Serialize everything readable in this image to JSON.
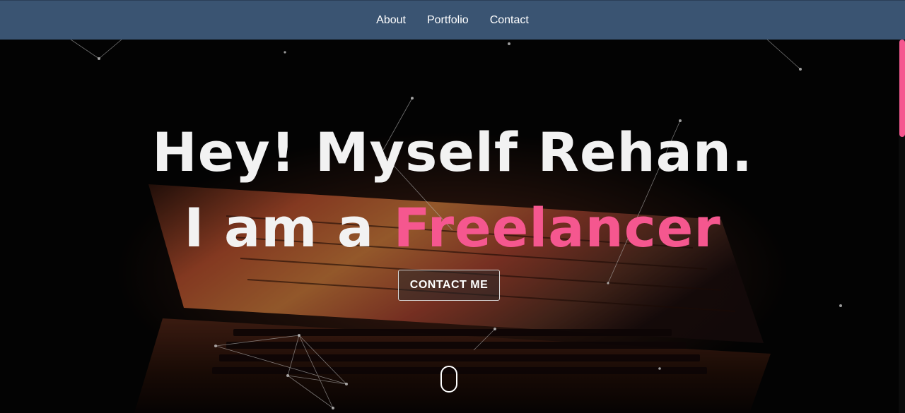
{
  "nav": {
    "items": [
      {
        "label": "About"
      },
      {
        "label": "Portfolio"
      },
      {
        "label": "Contact"
      }
    ]
  },
  "hero": {
    "line1": "Hey! Myself Rehan.",
    "line2_prefix": "I am a ",
    "line2_accent": "Freelancer",
    "cta_label": "CONTACT ME"
  },
  "colors": {
    "navbar": "#3a5472",
    "background": "#050505",
    "accent": "#f5578f",
    "text": "#f2f2f2"
  }
}
